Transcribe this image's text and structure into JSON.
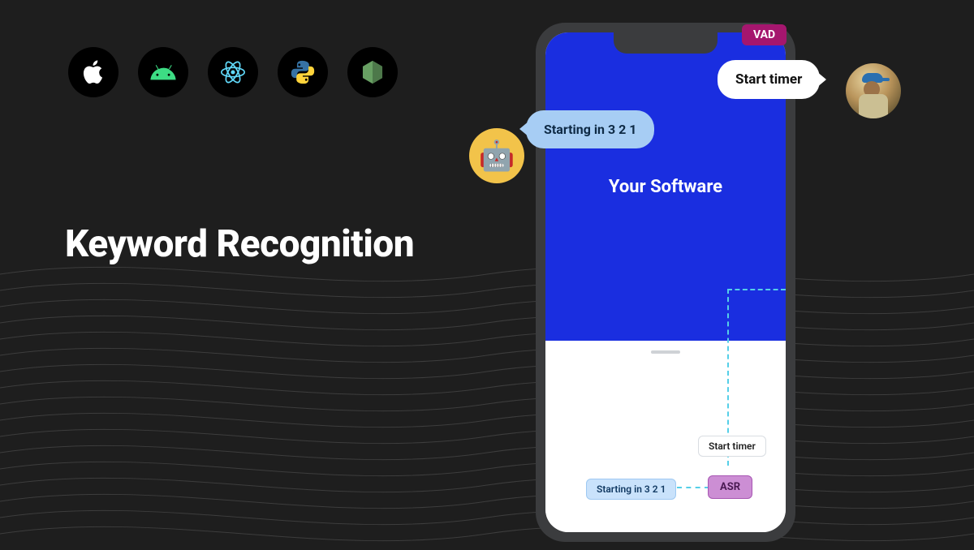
{
  "heading": "Keyword Recognition",
  "platforms": [
    {
      "name": "apple"
    },
    {
      "name": "android"
    },
    {
      "name": "react"
    },
    {
      "name": "python"
    },
    {
      "name": "node"
    }
  ],
  "phone": {
    "software_label": "Your Software",
    "asr_label": "ASR",
    "start_timer_chip": "Start timer",
    "countdown_chip": "Starting in 3 2 1"
  },
  "vad_label": "VAD",
  "user_bubble": "Start timer",
  "bot_bubble": "Starting in 3 2 1",
  "bot_emoji": "🤖"
}
